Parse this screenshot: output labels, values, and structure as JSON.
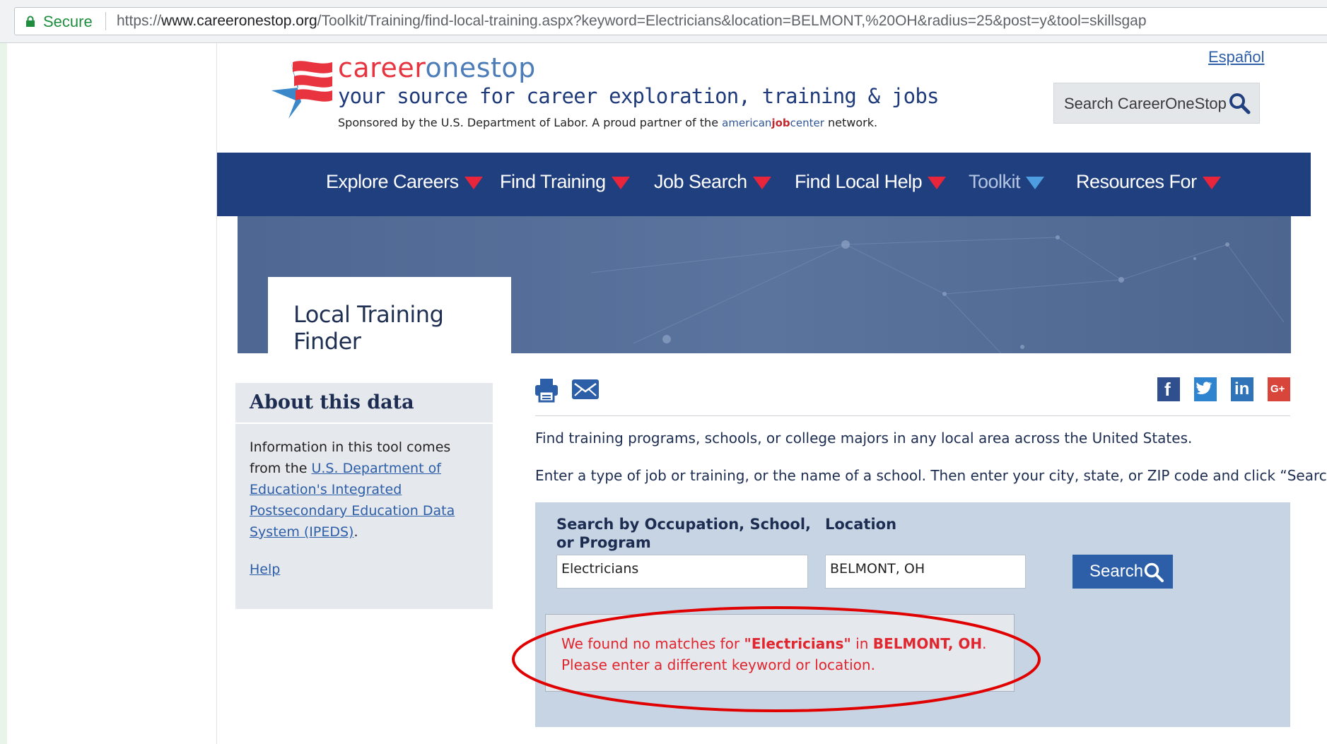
{
  "browser": {
    "secure_label": "Secure",
    "url_scheme": "https://",
    "url_host": "www.careeronestop.org",
    "url_path": "/Toolkit/Training/find-local-training.aspx?keyword=Electricians&location=BELMONT,%20OH&radius=25&post=y&tool=skillsgap"
  },
  "header": {
    "brand_part1": "career",
    "brand_part2": "onestop",
    "tagline": "your source for career exploration, training & jobs",
    "sponsor_prefix": "Sponsored by the U.S. Department of Labor. A proud partner of the ",
    "sponsor_ajc_1": "american",
    "sponsor_ajc_2": "job",
    "sponsor_ajc_3": "center",
    "sponsor_suffix": " network.",
    "language_link": "Español",
    "search_label": "Search CareerOneStop"
  },
  "nav": {
    "items": [
      {
        "label": "Explore Careers"
      },
      {
        "label": "Find Training"
      },
      {
        "label": "Job Search"
      },
      {
        "label": "Find Local Help"
      },
      {
        "label": "Toolkit"
      },
      {
        "label": "Resources For"
      }
    ]
  },
  "banner": {
    "title": "Local Training Finder"
  },
  "sidebar": {
    "title": "About this data",
    "text_prefix": "Information in this tool comes from the ",
    "link_text": "U.S. Department of Education's Integrated Postsecondary Education Data System (IPEDS)",
    "text_suffix": ".",
    "help_link": "Help"
  },
  "main": {
    "intro_line1": "Find training programs, schools, or college majors in any local area across the United States.",
    "intro_line2": "Enter a type of job or training, or the name of a school. Then enter your city, state, or ZIP code and click “Search.”",
    "search": {
      "keyword_label_line1": "Search by Occupation, School,",
      "keyword_label_line2": "or Program",
      "keyword_value": "Electricians",
      "location_label": "Location",
      "location_value": "BELMONT, OH",
      "button_label": "Search"
    },
    "alert": {
      "prefix": "We found no matches for ",
      "keyword": "\"Electricians\"",
      "middle": " in ",
      "location": "BELMONT, OH",
      "suffix": ".",
      "line2": "Please enter a different keyword or location."
    }
  },
  "social": {
    "facebook": "f",
    "linkedin": "in",
    "googleplus": "G+"
  },
  "colors": {
    "nav_bg": "#1f3f7f",
    "nav_arrow": "#e8253a",
    "alert_text": "#e0262f",
    "annotation_ring": "#e00000"
  }
}
